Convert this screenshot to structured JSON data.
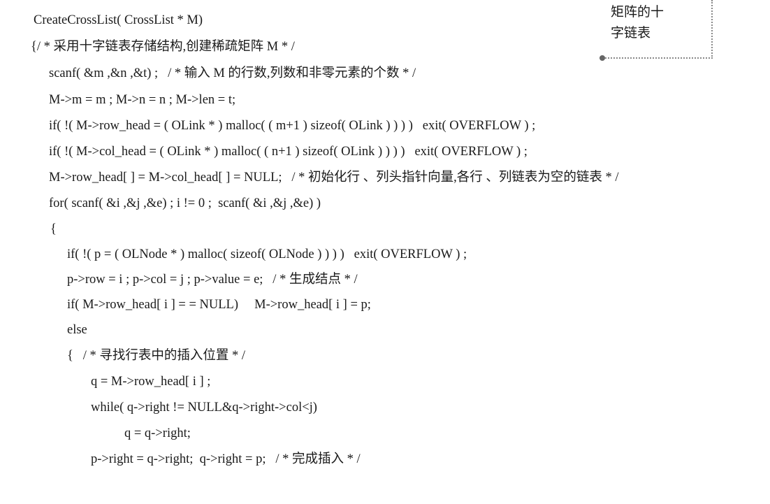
{
  "note": {
    "line1": "矩阵的十",
    "line2": "字链表"
  },
  "code": {
    "lines": [
      "CreateCrossList( CrossList * M)",
      "{/ * 采用十字链表存储结构,创建稀疏矩阵 M * /",
      "scanf( &m ,&n ,&t) ;   / * 输入 M 的行数,列数和非零元素的个数 * /",
      "M->m = m ; M->n = n ; M->len = t;",
      "if( !( M->row_head = ( OLink * ) malloc( ( m+1 ) sizeof( OLink ) ) ) )   exit( OVERFLOW ) ;",
      "if( !( M->col_head = ( OLink * ) malloc( ( n+1 ) sizeof( OLink ) ) ) )   exit( OVERFLOW ) ;",
      "M->row_head[ ] = M->col_head[ ] = NULL;   / * 初始化行 、列头指针向量,各行 、列链表为空的链表 * /",
      "for( scanf( &i ,&j ,&e) ; i != 0 ;  scanf( &i ,&j ,&e) )",
      "{",
      "if( !( p = ( OLNode * ) malloc( sizeof( OLNode ) ) ) )   exit( OVERFLOW ) ;",
      "p->row = i ; p->col = j ; p->value = e;   / * 生成结点 * /",
      "if( M->row_head[ i ] = = NULL)     M->row_head[ i ] = p;",
      "else",
      "{   / * 寻找行表中的插入位置 * /",
      "q = M->row_head[ i ] ;",
      "while( q->right != NULL&q->right->col<j)",
      "q = q->right;",
      "p->right = q->right;  q->right = p;   / * 完成插入 * /"
    ]
  }
}
